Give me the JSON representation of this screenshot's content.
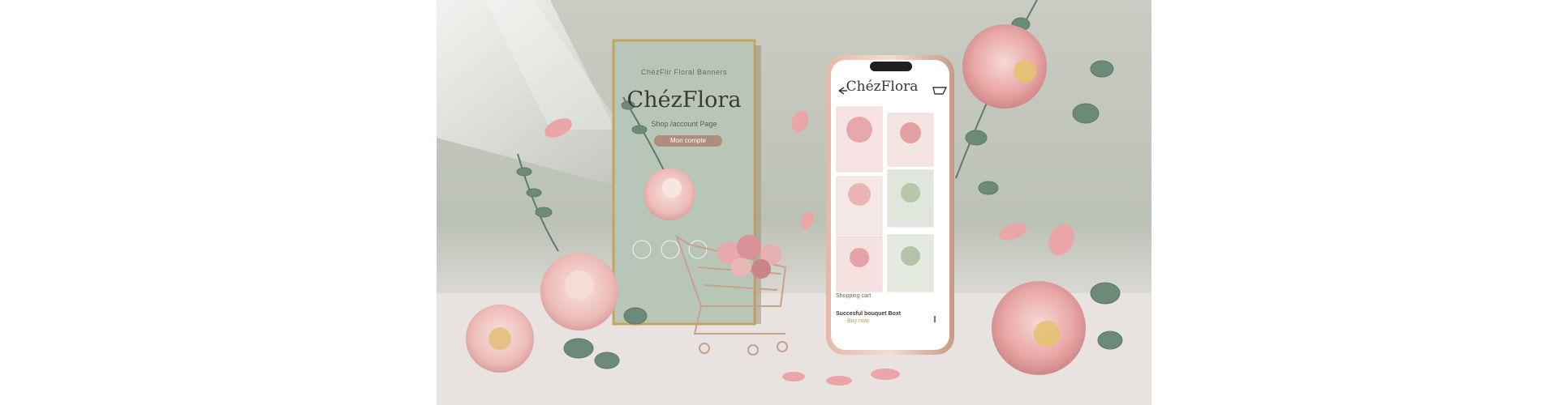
{
  "poster": {
    "brand_top": "ChézFlir Floral Banners",
    "logo": "ChézFlora",
    "subtitle": "Shop /account Page",
    "button": "Mon compte"
  },
  "phone": {
    "logo": "ChézFlora",
    "caption_1": "Shopping cart",
    "caption_2": "Succesful bouquet Boxt",
    "caption_3": "Buy now"
  },
  "colors": {
    "rose_pink": "#e9a8a8",
    "eucalyptus": "#5f7a6a",
    "poster_bg": "#b9c7b9",
    "rose_gold": "#c9a08c"
  },
  "icons": [
    "back-arrow-icon",
    "cart-icon",
    "more-icon",
    "shopping-cart-icon"
  ]
}
